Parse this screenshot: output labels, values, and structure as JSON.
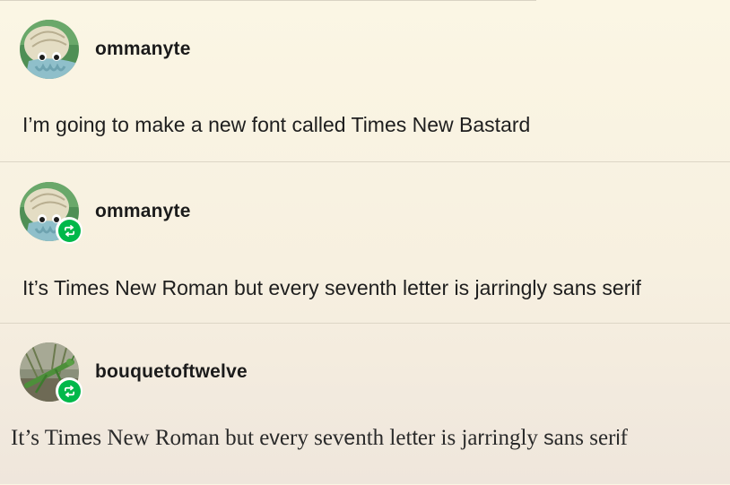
{
  "posts": [
    {
      "username": "ommanyte",
      "text": "I’m going to make a new font called Times New Bastard",
      "avatar_icon": "ommanyte-avatar",
      "reblogged": false
    },
    {
      "username": "ommanyte",
      "text": "It’s Times New Roman but every seventh letter is jarringly sans serif",
      "avatar_icon": "ommanyte-avatar",
      "reblogged": true,
      "badge_icon": "reblog-icon"
    },
    {
      "username": "bouquetoftwelve",
      "text": "It’s Times New Roman but every seventh letter is jarringly sans serif",
      "text_style": "mixed serif with every seventh letter sans serif",
      "avatar_icon": "grasshopper-avatar",
      "reblogged": true,
      "badge_icon": "reblog-icon"
    }
  ],
  "colors": {
    "background_top": "#fbf6e4",
    "background_bottom": "#efe6dc",
    "reblog_green": "#00b84a",
    "divider": "#ddd6c6"
  }
}
